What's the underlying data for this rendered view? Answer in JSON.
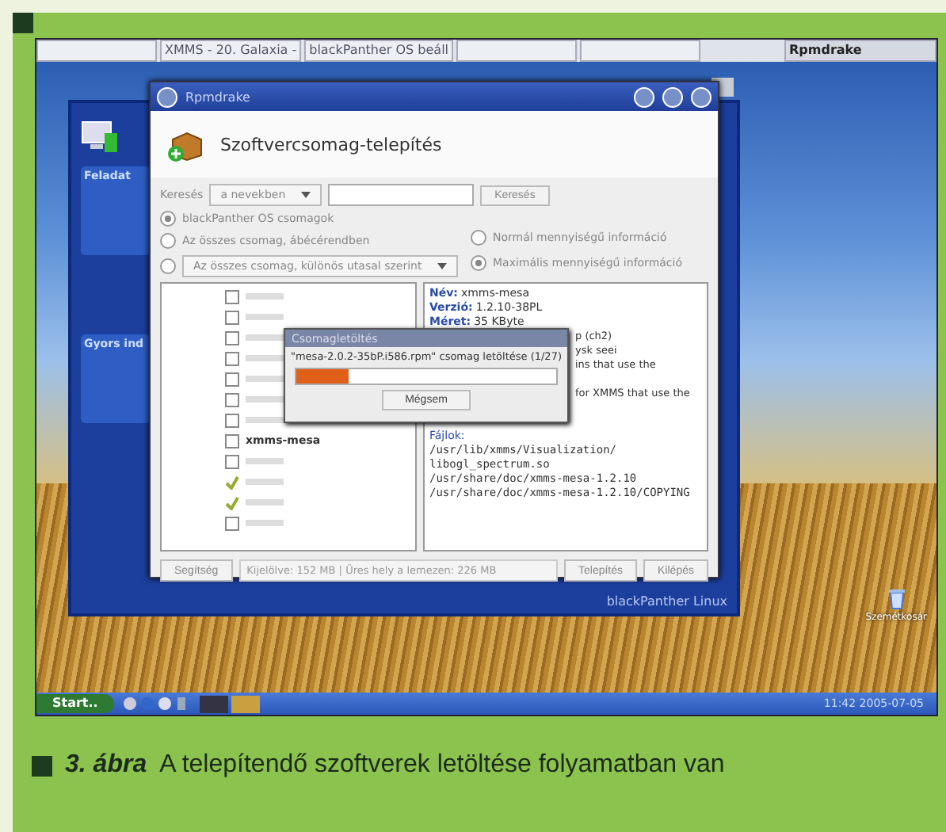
{
  "top_panel": {
    "tasks": [
      {
        "selected": false
      },
      {
        "label": "XMMS - 20. Galaxia -",
        "selected": false
      },
      {
        "label": "blackPanther OS beáll",
        "selected": false
      },
      {
        "selected": false
      },
      {
        "selected": false
      },
      {
        "label": "Rpmdrake",
        "selected": true
      }
    ]
  },
  "background_window": {
    "footer": "blackPanther Linux",
    "sections": [
      "Feladat",
      "Gyors ind"
    ]
  },
  "rpmdrake": {
    "title": "Rpmdrake",
    "heading": "Szoftvercsomag-telepítés",
    "search": {
      "label": "Keresés",
      "scope": "a nevekben",
      "button": "Keresés"
    },
    "filters": [
      {
        "label": "blackPanther OS csomagok",
        "selected": true
      },
      {
        "label": "Az összes csomag, ábécérendben",
        "selected": false
      },
      {
        "label": "Az összes csomag, különös utasal szerint",
        "selected": false,
        "kind": "dropdown"
      }
    ],
    "info_levels": [
      {
        "label": "Normál mennyiségű információ",
        "selected": false
      },
      {
        "label": "Maximális mennyiségű információ",
        "selected": true
      }
    ],
    "packages": [
      {
        "checked": false
      },
      {
        "checked": false
      },
      {
        "checked": false
      },
      {
        "checked": false
      },
      {
        "checked": false
      },
      {
        "checked": false
      },
      {
        "checked": false
      },
      {
        "label": "xmms-mesa",
        "checked": false
      },
      {
        "checked": false
      },
      {
        "checked": true
      },
      {
        "checked": true
      },
      {
        "checked": false
      }
    ],
    "details": [
      {
        "kind": "field",
        "label": "Név:",
        "value": "xmms-mesa"
      },
      {
        "kind": "field",
        "label": "Verzió:",
        "value": "1.2.10-38PL"
      },
      {
        "kind": "field",
        "label": "Méret:",
        "value": "35 KByte"
      },
      {
        "kind": "text",
        "value": "p (ch2)"
      },
      {
        "kind": "text",
        "value": "ysk seei"
      },
      {
        "kind": "text",
        "value": "ins that use the"
      },
      {
        "kind": "gap"
      },
      {
        "kind": "text",
        "value": "for XMMS that use the"
      },
      {
        "kind": "gap"
      },
      {
        "kind": "gap"
      },
      {
        "kind": "heading",
        "value": "Fájlok:"
      },
      {
        "kind": "mono",
        "value": "/usr/lib/xmms/Visualization/"
      },
      {
        "kind": "mono",
        "value": "libogl_spectrum.so"
      },
      {
        "kind": "mono",
        "value": "/usr/share/doc/xmms-mesa-1.2.10"
      },
      {
        "kind": "mono",
        "value": "/usr/share/doc/xmms-mesa-1.2.10/COPYING"
      }
    ],
    "buttons": [
      {
        "kind": "button",
        "label": "Segítség"
      },
      {
        "kind": "status",
        "label": "Kijelölve: 152 MB | Üres hely a lemezen: 226 MB"
      },
      {
        "kind": "button",
        "label": "Telepítés"
      },
      {
        "kind": "button",
        "label": "Kilépés"
      }
    ]
  },
  "progress_dialog": {
    "title": "Csomagletöltés",
    "message": "\"mesa-2.0.2-35bP.i586.rpm\" csomag letöltése (1/27)",
    "level": 0.2,
    "button": "Mégsem"
  },
  "desktop_icon": {
    "label": "Szemétkosár"
  },
  "taskbar": {
    "start": "Start..",
    "clock": "11:42 2005-07-05"
  },
  "caption": {
    "number": "3. ábra",
    "text": "A telepítendő szoftverek letöltése folyamatban van"
  }
}
